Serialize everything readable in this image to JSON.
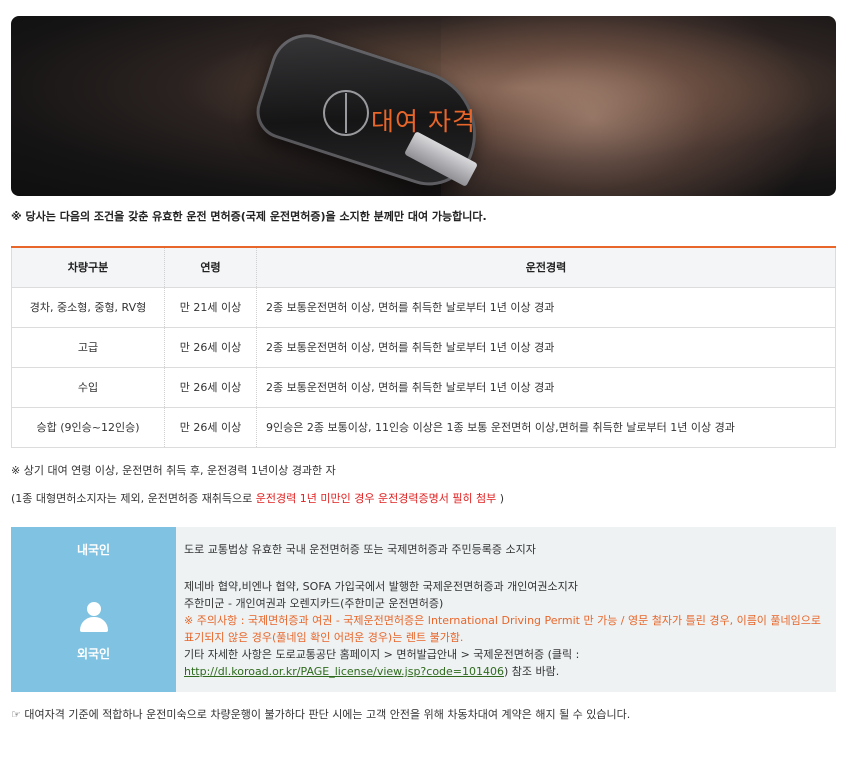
{
  "banner": {
    "title": "대여 자격"
  },
  "notice_main": "※ 당사는 다음의 조건을 갖춘 유효한 운전 면허증(국제 운전면허증)을 소지한 분께만 대여 가능합니다.",
  "table": {
    "headers": [
      "차량구분",
      "연령",
      "운전경력"
    ],
    "rows": [
      [
        "경차, 중소형, 중형, RV형",
        "만 21세 이상",
        "2종 보통운전면허 이상, 면허를 취득한 날로부터 1년 이상 경과"
      ],
      [
        "고급",
        "만 26세 이상",
        "2종 보통운전면허 이상, 면허를 취득한 날로부터 1년 이상 경과"
      ],
      [
        "수입",
        "만 26세 이상",
        "2종 보통운전면허 이상, 면허를 취득한 날로부터 1년 이상 경과"
      ],
      [
        "승합 (9인승~12인승)",
        "만 26세 이상",
        "9인승은 2종 보통이상, 11인승 이상은 1종 보통 운전면허 이상,면허를 취득한 날로부터 1년 이상 경과"
      ]
    ]
  },
  "note1": "※ 상기 대여 연령 이상, 운전면허 취득 후, 운전경력 1년이상 경과한 자",
  "note2": {
    "prefix": "(1종 대형면허소지자는 제외, 운전면허증 재취득으로 ",
    "highlight": "운전경력 1년 미만인 경우 운전경력증명서 필히 첨부",
    "suffix": " )"
  },
  "license": {
    "domestic_label": "내국인",
    "domestic_text": "도로 교통법상 유효한 국내 운전면허증 또는 국제면허증과 주민등록증 소지자",
    "foreign_label": "외국인",
    "foreign_line1": "제네바 협약,비엔나 협약, SOFA 가입국에서 발행한 국제운전면허증과 개인여권소지자",
    "foreign_line2": "주한미군 - 개인여권과 오렌지카드(주한미군 운전면허증)",
    "foreign_warning": "※ 주의사항 : 국제면허증과 여권 - 국제운전면허증은 International Driving Permit 만 가능 / 영문 철자가 틀린 경우, 이름이 풀네임으로 표기되지 않은 경우(풀네임 확인 어려운 경우)는 렌트 불가함.",
    "foreign_info_prefix": "기타 자세한 사항은 도로교통공단 홈페이지 > 면허발급안내 > 국제운전면허증 (클릭 : ",
    "foreign_link": "http://dl.koroad.or.kr/PAGE_license/view.jsp?code=101406",
    "foreign_info_suffix": ") 참조 바람."
  },
  "bottom_note": "☞ 대여자격 기준에 적합하나 운전미숙으로 차량운행이 불가하다 판단 시에는 고객 안전을 위해 차동차대여 계약은 해지 될 수 있습니다.",
  "colors": {
    "accent": "#e8662a",
    "label_bg": "#7fc2e1",
    "warning_red": "#e02020",
    "link_green": "#2f6a1e"
  }
}
